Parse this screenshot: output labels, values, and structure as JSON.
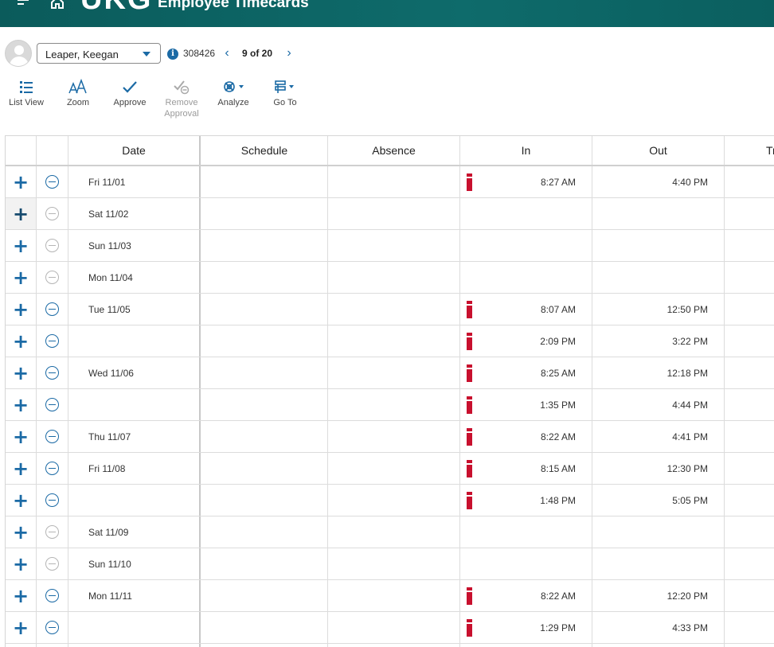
{
  "header": {
    "logo": "UKG",
    "title": "Employee Timecards"
  },
  "employee": {
    "name": "Leaper, Keegan",
    "id": "308426",
    "position_label": "9 of 20"
  },
  "toolbar": {
    "list_view": "List View",
    "zoom": "Zoom",
    "approve": "Approve",
    "remove_approval": "Remove Approval",
    "analyze": "Analyze",
    "go_to": "Go To"
  },
  "columns": {
    "date": "Date",
    "schedule": "Schedule",
    "absence": "Absence",
    "in": "In",
    "out": "Out",
    "transfer": "Tr"
  },
  "rows": [
    {
      "date": "Fri 11/01",
      "in": "8:27 AM",
      "out": "4:40 PM",
      "removable": true,
      "punch": true
    },
    {
      "date": "Sat 11/02",
      "in": "",
      "out": "",
      "removable": false,
      "punch": false,
      "hover": true
    },
    {
      "date": "Sun 11/03",
      "in": "",
      "out": "",
      "removable": false,
      "punch": false
    },
    {
      "date": "Mon 11/04",
      "in": "",
      "out": "",
      "removable": false,
      "punch": false
    },
    {
      "date": "Tue 11/05",
      "in": "8:07 AM",
      "out": "12:50 PM",
      "removable": true,
      "punch": true
    },
    {
      "date": "",
      "in": "2:09 PM",
      "out": "3:22 PM",
      "removable": true,
      "punch": true
    },
    {
      "date": "Wed 11/06",
      "in": "8:25 AM",
      "out": "12:18 PM",
      "removable": true,
      "punch": true
    },
    {
      "date": "",
      "in": "1:35 PM",
      "out": "4:44 PM",
      "removable": true,
      "punch": true
    },
    {
      "date": "Thu 11/07",
      "in": "8:22 AM",
      "out": "4:41 PM",
      "removable": true,
      "punch": true
    },
    {
      "date": "Fri 11/08",
      "in": "8:15 AM",
      "out": "12:30 PM",
      "removable": true,
      "punch": true
    },
    {
      "date": "",
      "in": "1:48 PM",
      "out": "5:05 PM",
      "removable": true,
      "punch": true
    },
    {
      "date": "Sat 11/09",
      "in": "",
      "out": "",
      "removable": false,
      "punch": false
    },
    {
      "date": "Sun 11/10",
      "in": "",
      "out": "",
      "removable": false,
      "punch": false
    },
    {
      "date": "Mon 11/11",
      "in": "8:22 AM",
      "out": "12:20 PM",
      "removable": true,
      "punch": true
    },
    {
      "date": "",
      "in": "1:29 PM",
      "out": "4:33 PM",
      "removable": true,
      "punch": true
    },
    {
      "date": "",
      "in": "",
      "out": "",
      "removable": true,
      "punch": false
    }
  ],
  "colors": {
    "header_bg": "#0e6b6b",
    "accent": "#1b6aa5",
    "punch_marker": "#c8102e"
  }
}
